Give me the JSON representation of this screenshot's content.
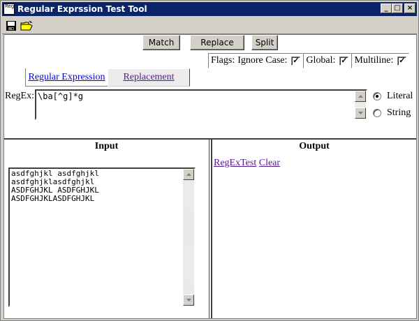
{
  "window": {
    "title": "Regular Exprssion Test Tool",
    "app_icon_text": "RegEx"
  },
  "toolbar": {
    "save_icon": "save-icon",
    "open_icon": "open-folder-icon"
  },
  "actions": {
    "match": "Match",
    "replace": "Replace",
    "split": "Split"
  },
  "flags": {
    "label": "Flags:",
    "ignore_case": {
      "label": "Ignore Case:",
      "checked": true
    },
    "global": {
      "label": "Global:",
      "checked": true
    },
    "multiline": {
      "label": "Multiline:",
      "checked": true
    }
  },
  "tabs": [
    {
      "label": "Regular Expression",
      "active": false
    },
    {
      "label": "Replacement",
      "active": true
    }
  ],
  "regex": {
    "label": "RegEx:",
    "value": "\\ba[^g]*g",
    "mode_options": [
      {
        "label": "Literal",
        "selected": true
      },
      {
        "label": "String",
        "selected": false
      }
    ]
  },
  "input_panel": {
    "header": "Input",
    "lines": [
      "asdfghjkl asdfghjkl",
      "asdfghjklasdfghjkl",
      "ASDFGHJKL ASDFGHJKL",
      "ASDFGHJKLASDFGHJKL"
    ]
  },
  "output_panel": {
    "header": "Output",
    "links": {
      "regextest": "RegExTest",
      "clear": "Clear"
    }
  }
}
